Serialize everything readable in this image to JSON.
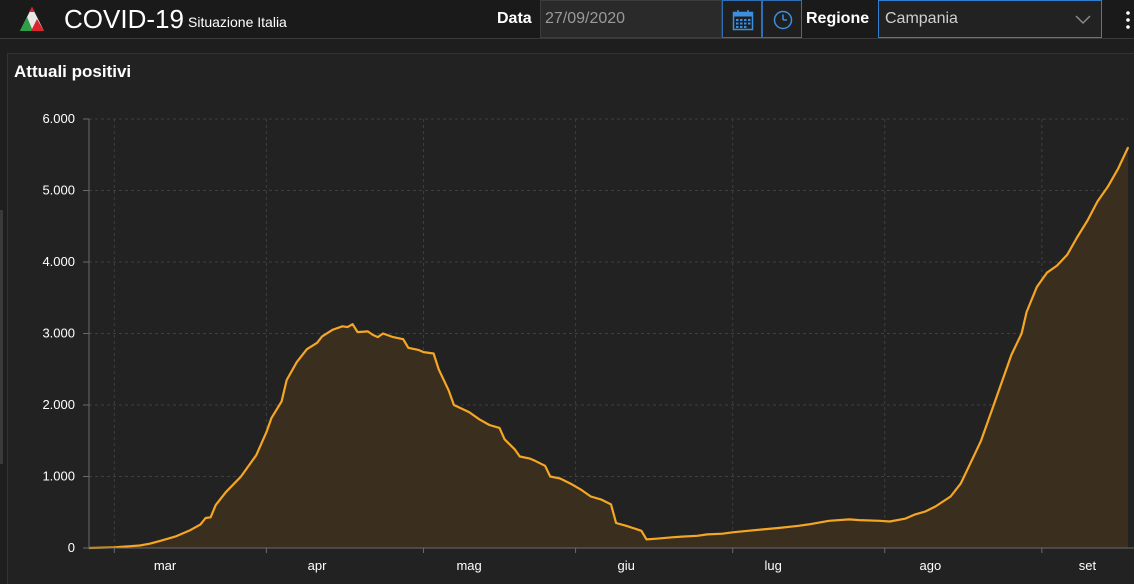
{
  "header": {
    "app_title": "COVID-19",
    "app_subtitle": "Situazione Italia",
    "date_label": "Data",
    "date_value": "27/09/2020",
    "region_label": "Regione",
    "region_value": "Campania",
    "icons": [
      "logo-icon",
      "calendar-icon",
      "clock-icon",
      "chevron-down-icon",
      "more-icon"
    ]
  },
  "colors": {
    "accent_line": "#f5a623",
    "area_fill": "#3a2e1e",
    "focus_border": "#2f7fd0",
    "background": "#1e1e1e"
  },
  "chart_data": {
    "type": "area",
    "title": "Attuali positivi",
    "xlabel": "",
    "ylabel": "",
    "ylim": [
      0,
      6000
    ],
    "y_ticks": [
      {
        "value": 0,
        "label": "0"
      },
      {
        "value": 1000,
        "label": "1.000"
      },
      {
        "value": 2000,
        "label": "2.000"
      },
      {
        "value": 3000,
        "label": "3.000"
      },
      {
        "value": 4000,
        "label": "4.000"
      },
      {
        "value": 5000,
        "label": "5.000"
      },
      {
        "value": 6000,
        "label": "6.000"
      }
    ],
    "x_ticks": [
      {
        "day": 15,
        "label": "mar"
      },
      {
        "day": 45,
        "label": "apr"
      },
      {
        "day": 75,
        "label": "mag"
      },
      {
        "day": 106,
        "label": "giu"
      },
      {
        "day": 135,
        "label": "lug"
      },
      {
        "day": 166,
        "label": "ago"
      },
      {
        "day": 197,
        "label": "set"
      }
    ],
    "x_gridlines_days": [
      5,
      35,
      66,
      96,
      127,
      157,
      188
    ],
    "grid": true,
    "legend": "none",
    "series": [
      {
        "name": "",
        "points": [
          [
            0,
            0
          ],
          [
            3,
            5
          ],
          [
            5,
            10
          ],
          [
            7,
            20
          ],
          [
            10,
            35
          ],
          [
            12,
            60
          ],
          [
            14,
            100
          ],
          [
            17,
            160
          ],
          [
            20,
            250
          ],
          [
            22,
            330
          ],
          [
            23,
            420
          ],
          [
            24,
            430
          ],
          [
            25,
            600
          ],
          [
            27,
            780
          ],
          [
            30,
            1000
          ],
          [
            33,
            1300
          ],
          [
            35,
            1620
          ],
          [
            36,
            1820
          ],
          [
            38,
            2050
          ],
          [
            39,
            2350
          ],
          [
            41,
            2600
          ],
          [
            43,
            2780
          ],
          [
            45,
            2870
          ],
          [
            46,
            2960
          ],
          [
            48,
            3050
          ],
          [
            50,
            3100
          ],
          [
            51,
            3090
          ],
          [
            52,
            3130
          ],
          [
            53,
            3020
          ],
          [
            55,
            3030
          ],
          [
            56,
            2980
          ],
          [
            57,
            2950
          ],
          [
            58,
            3000
          ],
          [
            60,
            2950
          ],
          [
            62,
            2920
          ],
          [
            63,
            2800
          ],
          [
            65,
            2770
          ],
          [
            66,
            2740
          ],
          [
            68,
            2720
          ],
          [
            69,
            2500
          ],
          [
            71,
            2200
          ],
          [
            72,
            2000
          ],
          [
            75,
            1900
          ],
          [
            77,
            1800
          ],
          [
            79,
            1720
          ],
          [
            81,
            1680
          ],
          [
            82,
            1520
          ],
          [
            84,
            1380
          ],
          [
            85,
            1280
          ],
          [
            87,
            1250
          ],
          [
            88,
            1220
          ],
          [
            90,
            1150
          ],
          [
            91,
            1000
          ],
          [
            93,
            970
          ],
          [
            95,
            900
          ],
          [
            97,
            820
          ],
          [
            99,
            720
          ],
          [
            101,
            680
          ],
          [
            103,
            610
          ],
          [
            104,
            350
          ],
          [
            106,
            310
          ],
          [
            109,
            240
          ],
          [
            110,
            120
          ],
          [
            112,
            130
          ],
          [
            115,
            150
          ],
          [
            117,
            160
          ],
          [
            120,
            170
          ],
          [
            122,
            190
          ],
          [
            125,
            200
          ],
          [
            127,
            220
          ],
          [
            130,
            240
          ],
          [
            133,
            260
          ],
          [
            136,
            280
          ],
          [
            140,
            310
          ],
          [
            142,
            330
          ],
          [
            146,
            380
          ],
          [
            150,
            400
          ],
          [
            152,
            390
          ],
          [
            156,
            380
          ],
          [
            158,
            370
          ],
          [
            161,
            410
          ],
          [
            163,
            470
          ],
          [
            165,
            510
          ],
          [
            167,
            580
          ],
          [
            170,
            720
          ],
          [
            172,
            900
          ],
          [
            174,
            1200
          ],
          [
            176,
            1500
          ],
          [
            178,
            1900
          ],
          [
            180,
            2300
          ],
          [
            182,
            2700
          ],
          [
            184,
            3000
          ],
          [
            185,
            3300
          ],
          [
            187,
            3650
          ],
          [
            189,
            3850
          ],
          [
            191,
            3950
          ],
          [
            193,
            4100
          ],
          [
            195,
            4350
          ],
          [
            197,
            4580
          ],
          [
            199,
            4850
          ],
          [
            201,
            5050
          ],
          [
            203,
            5300
          ],
          [
            205,
            5600
          ]
        ]
      }
    ]
  }
}
